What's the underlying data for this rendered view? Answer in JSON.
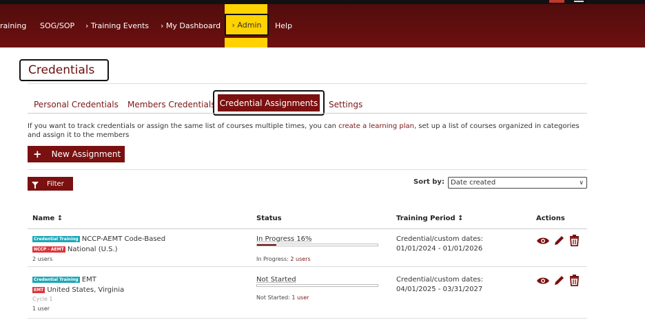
{
  "nav": {
    "items": [
      {
        "label": "raining"
      },
      {
        "label": "SOG/SOP"
      },
      {
        "label": "› Training Events"
      },
      {
        "label": "› My Dashboard"
      },
      {
        "label": "› Admin"
      },
      {
        "label": "Help"
      }
    ]
  },
  "page": {
    "title": "Credentials"
  },
  "tabs": [
    {
      "label": "Personal Credentials"
    },
    {
      "label": "Members Credentials"
    },
    {
      "label": "Credential Assignments",
      "active": true
    },
    {
      "label": "Settings"
    }
  ],
  "info": {
    "before": "If you want to track credentials or assign the same list of courses multiple times, you can ",
    "link": "create a learning plan",
    "after": ", set up a list of courses organized in categories and assign it to the members"
  },
  "toolbar": {
    "new_assignment": "New Assignment",
    "filter": "Filter",
    "sort_label": "Sort by:",
    "sort_value": "Date created"
  },
  "table": {
    "headers": {
      "name": "Name ↕",
      "status": "Status",
      "period": "Training Period ↕",
      "actions": "Actions"
    },
    "rows": [
      {
        "type_badge": "Credential Training",
        "name": "NCCP-AEMT Code-Based",
        "cred_badge": "NCCP - AEMT",
        "region": "National (U.S.)",
        "cycle": "",
        "users": "2 users",
        "status": "In Progress 16%",
        "progress": 0.16,
        "status_sub_label": "In Progress:",
        "status_sub_link": "2 users",
        "period_label": "Credential/custom dates:",
        "period_dates": "01/01/2024 - 01/01/2026"
      },
      {
        "type_badge": "Credential Training",
        "name": "EMT",
        "cred_badge": "EMT",
        "region": "United States, Virginia",
        "cycle": "Cycle 1",
        "users": "1 user",
        "status": "Not Started",
        "progress": 0,
        "status_sub_label": "Not Started:",
        "status_sub_link": "1 user",
        "period_label": "Credential/custom dates:",
        "period_dates": "04/01/2025 - 03/31/2027"
      }
    ]
  },
  "colors": {
    "brand": "#7a1010",
    "highlight": "#ffd200",
    "teal": "#1aa7b7",
    "red": "#d9363e"
  },
  "icons": [
    "view-icon",
    "edit-icon",
    "delete-icon",
    "plus-icon",
    "filter-icon",
    "chevron-down-icon"
  ]
}
